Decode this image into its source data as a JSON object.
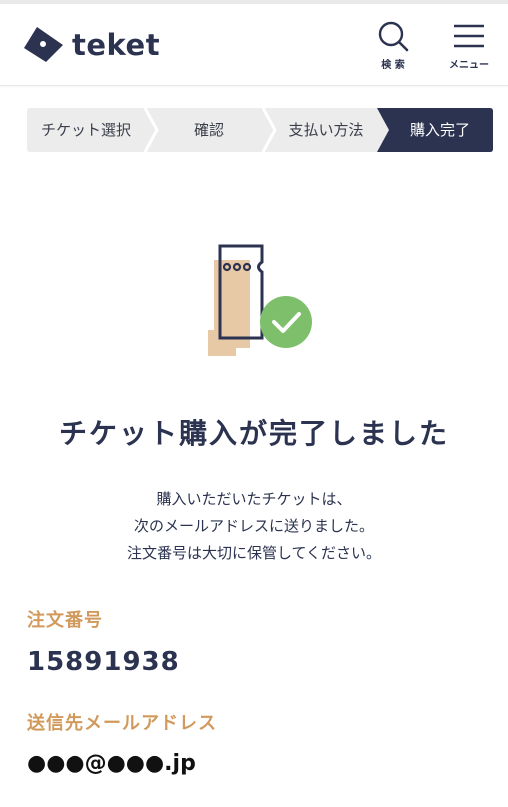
{
  "header": {
    "logo_text": "teket",
    "search_label": "検 索",
    "menu_label": "メニュー"
  },
  "steps": [
    {
      "label": "チケット選択",
      "active": false
    },
    {
      "label": "確認",
      "active": false
    },
    {
      "label": "支払い方法",
      "active": false
    },
    {
      "label": "購入完了",
      "active": true
    }
  ],
  "main": {
    "title": "チケット購入が完了しました",
    "desc_lines": [
      "購入いただいたチケットは、",
      "次のメールアドレスに送りました。",
      "注文番号は大切に保管してください。"
    ],
    "order_label": "注文番号",
    "order_number": "15891938",
    "mail_label": "送信先メールアドレス",
    "mail_value": "●●●@●●●.jp"
  },
  "colors": {
    "navy": "#2b3350",
    "orange": "#d19a5c",
    "green": "#7dbf6a",
    "step_bg": "#ececec",
    "ticket_fill": "#e7c9a6"
  }
}
